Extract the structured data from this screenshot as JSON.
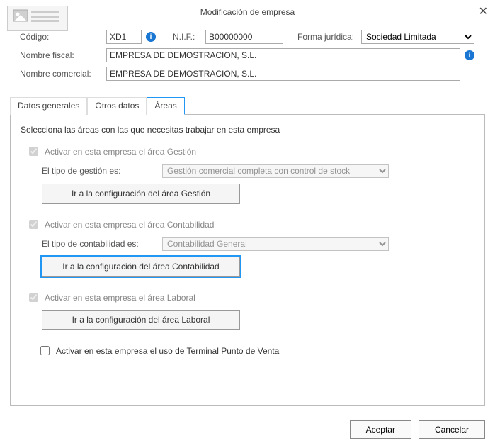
{
  "title": "Modificación de empresa",
  "header": {
    "codigo_label": "Código:",
    "codigo_value": "XD1",
    "nif_label": "N.I.F.:",
    "nif_value": "B00000000",
    "forma_label": "Forma jurídica:",
    "forma_value": "Sociedad Limitada",
    "nombre_fiscal_label": "Nombre fiscal:",
    "nombre_fiscal_value": "EMPRESA DE DEMOSTRACION, S.L.",
    "nombre_comercial_label": "Nombre comercial:",
    "nombre_comercial_value": "EMPRESA DE DEMOSTRACION, S.L."
  },
  "tabs": {
    "datos_generales": "Datos generales",
    "otros_datos": "Otros datos",
    "areas": "Áreas"
  },
  "panel": {
    "intro": "Selecciona las áreas con las que necesitas trabajar en esta empresa",
    "gestion_chk": "Activar en esta empresa el área Gestión",
    "gestion_tipo_label": "El tipo de gestión es:",
    "gestion_tipo_value": "Gestión comercial completa con control de stock",
    "gestion_btn": "Ir a la configuración del área Gestión",
    "contab_chk": "Activar en esta empresa el área Contabilidad",
    "contab_tipo_label": "El tipo de contabilidad es:",
    "contab_tipo_value": "Contabilidad General",
    "contab_btn": "Ir a la configuración del área Contabilidad",
    "laboral_chk": "Activar en esta empresa el área Laboral",
    "laboral_btn": "Ir a la configuración del área Laboral",
    "tpv_chk": "Activar en esta empresa el uso de Terminal Punto de Venta"
  },
  "footer": {
    "accept": "Aceptar",
    "cancel": "Cancelar"
  }
}
